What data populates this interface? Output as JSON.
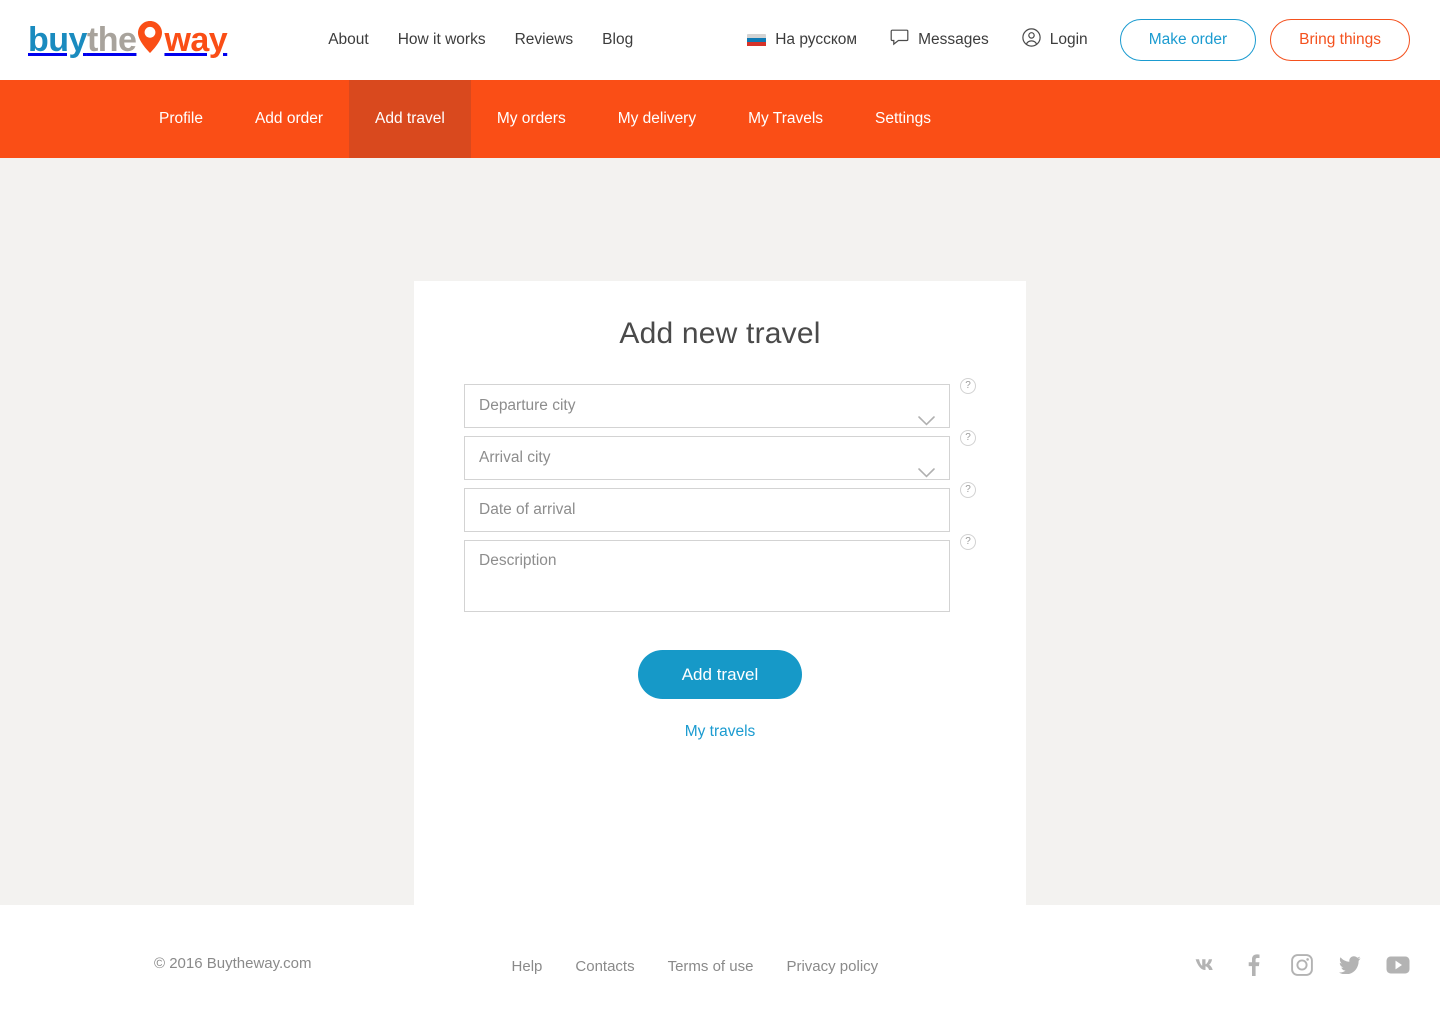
{
  "header": {
    "logo": {
      "part1": "buy",
      "part2": "the",
      "part3": "way",
      "pin_icon": "map-pin-icon",
      "color_buy": "#1a8bbf",
      "color_the": "#a8a39c",
      "color_way": "#fa4e16"
    },
    "nav": [
      {
        "label": "About"
      },
      {
        "label": "How it works"
      },
      {
        "label": "Reviews"
      },
      {
        "label": "Blog"
      }
    ],
    "utils": [
      {
        "label": "На русском",
        "icon": "russian-flag-icon"
      },
      {
        "label": "Messages",
        "icon": "speech-bubble-icon"
      },
      {
        "label": "Login",
        "icon": "user-circle-icon"
      }
    ],
    "buttons": {
      "make_order": "Make order",
      "bring_things": "Bring things",
      "make_order_color": "#1b9bd0",
      "bring_things_color": "#f4511e"
    }
  },
  "subnav": {
    "background": "#fa4e16",
    "active_background": "#d9491e",
    "items": [
      {
        "label": "Profile",
        "active": false
      },
      {
        "label": "Add order",
        "active": false
      },
      {
        "label": "Add travel",
        "active": true
      },
      {
        "label": "My orders",
        "active": false
      },
      {
        "label": "My delivery",
        "active": false
      },
      {
        "label": "My Travels",
        "active": false
      },
      {
        "label": "Settings",
        "active": false
      }
    ]
  },
  "form": {
    "title": "Add new travel",
    "help_glyph": "?",
    "fields": [
      {
        "name": "departure-city",
        "placeholder": "Departure city",
        "value": "",
        "type": "select"
      },
      {
        "name": "arrival-city",
        "placeholder": "Arrival city",
        "value": "",
        "type": "select"
      },
      {
        "name": "date-of-arrival",
        "placeholder": "Date of arrival",
        "value": "",
        "type": "text"
      },
      {
        "name": "description",
        "placeholder": "Description",
        "value": "",
        "type": "textarea"
      }
    ],
    "submit_label": "Add travel",
    "submit_color": "#1699c8",
    "link_label": "My travels",
    "link_color": "#1b9bd0"
  },
  "footer": {
    "copyright": "© 2016 Buytheway.com",
    "links": [
      {
        "label": "Help"
      },
      {
        "label": "Contacts"
      },
      {
        "label": "Terms of use"
      },
      {
        "label": "Privacy policy"
      }
    ],
    "social": [
      {
        "name": "vk-icon"
      },
      {
        "name": "facebook-icon"
      },
      {
        "name": "instagram-icon"
      },
      {
        "name": "twitter-icon"
      },
      {
        "name": "youtube-icon"
      }
    ]
  }
}
